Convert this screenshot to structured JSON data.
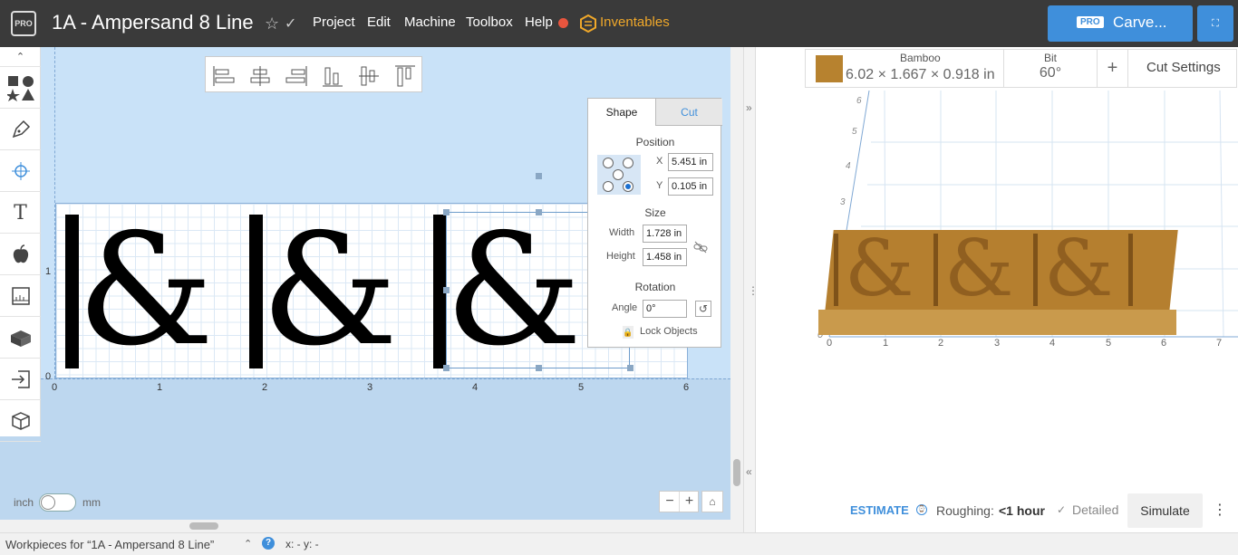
{
  "header": {
    "badge": "PRO",
    "project_title": "1A - Ampersand 8 Line",
    "star": "☆",
    "check": "✓",
    "menus": [
      "Project",
      "Edit",
      "Machine",
      "Toolbox",
      "Help"
    ],
    "inventables": "Inventables",
    "carve_badge": "PRO",
    "carve_label": "Carve...",
    "expand": "⛶"
  },
  "left_toolbar": {
    "collapse": "⌃",
    "tools": [
      "shapes-icon",
      "pen-icon",
      "point-icon",
      "text-icon",
      "apple-icon",
      "ruler-icon",
      "lego-icon",
      "import-icon",
      "cube-icon"
    ]
  },
  "canvas": {
    "x_ticks": [
      "0",
      "1",
      "2",
      "3",
      "4",
      "5",
      "6"
    ],
    "y_ticks": [
      "0",
      "1"
    ],
    "glyph": "&",
    "unit_inch": "inch",
    "unit_mm": "mm",
    "zoom_out": "−",
    "zoom_in": "+",
    "home": "⌂"
  },
  "shape_panel": {
    "tab_shape": "Shape",
    "tab_cut": "Cut",
    "position_heading": "Position",
    "x_label": "X",
    "x_value": "5.451 in",
    "y_label": "Y",
    "y_value": "0.105 in",
    "size_heading": "Size",
    "width_label": "Width",
    "width_value": "1.728 in",
    "height_label": "Height",
    "height_value": "1.458 in",
    "rotation_heading": "Rotation",
    "angle_label": "Angle",
    "angle_value": "0°",
    "lock_label": "Lock Objects"
  },
  "material_bar": {
    "material": "Bamboo",
    "dimensions": "6.02 × 1.667 × 0.918 in",
    "bit_label": "Bit",
    "bit_value": "60°",
    "plus": "+",
    "cut_settings": "Cut Settings"
  },
  "preview": {
    "y_ticks": [
      "6",
      "5",
      "4",
      "3"
    ],
    "x_ticks": [
      "0",
      "1",
      "2",
      "3",
      "4",
      "5",
      "6",
      "7"
    ],
    "origin": "0"
  },
  "estimate": {
    "label": "ESTIMATE",
    "roughing_label": "Roughing:",
    "roughing_value": "<1 hour",
    "detailed_check": "✓",
    "detailed_label": "Detailed",
    "simulate": "Simulate",
    "more": "⋮"
  },
  "bottom_bar": {
    "workpieces_label": "Workpieces for “1A - Ampersand 8 Line”",
    "caret": "⌃",
    "help": "?",
    "coords": "x: - y: -"
  },
  "colors": {
    "topbar": "#3a3a3a",
    "accent": "#3f8fdb",
    "inventables": "#f0a82a",
    "record": "#e8553e",
    "wood": "#b7822f"
  }
}
